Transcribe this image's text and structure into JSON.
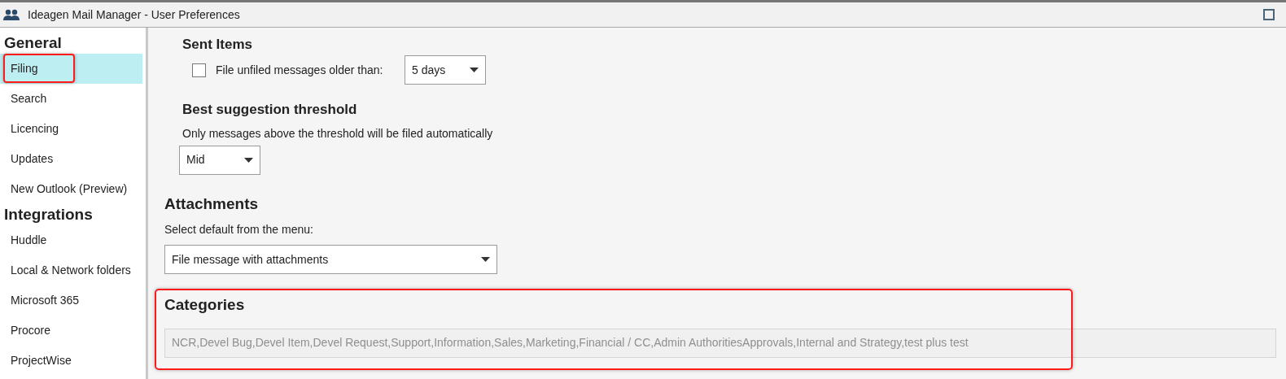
{
  "window": {
    "title": "Ideagen Mail Manager - User Preferences"
  },
  "sidebar": {
    "sections": [
      {
        "heading": "General",
        "items": [
          {
            "label": "Filing",
            "selected": true,
            "highlighted": true
          },
          {
            "label": "Search",
            "selected": false,
            "highlighted": false
          },
          {
            "label": "Licencing",
            "selected": false,
            "highlighted": false
          },
          {
            "label": "Updates",
            "selected": false,
            "highlighted": false
          },
          {
            "label": "New Outlook (Preview)",
            "selected": false,
            "highlighted": false
          }
        ]
      },
      {
        "heading": "Integrations",
        "items": [
          {
            "label": "Huddle",
            "selected": false,
            "highlighted": false
          },
          {
            "label": "Local & Network folders",
            "selected": false,
            "highlighted": false
          },
          {
            "label": "Microsoft 365",
            "selected": false,
            "highlighted": false
          },
          {
            "label": "Procore",
            "selected": false,
            "highlighted": false
          },
          {
            "label": "ProjectWise",
            "selected": false,
            "highlighted": false
          }
        ]
      }
    ]
  },
  "sent_items": {
    "heading": "Sent Items",
    "checkbox": {
      "label": "File unfiled messages older than:",
      "checked": false
    },
    "dropdown": {
      "value": "5 days"
    }
  },
  "best_suggestion": {
    "heading": "Best suggestion threshold",
    "description": "Only messages above the threshold will be filed automatically",
    "dropdown": {
      "value": "Mid"
    }
  },
  "attachments": {
    "heading": "Attachments",
    "label": "Select default from the menu:",
    "dropdown": {
      "value": "File message with attachments"
    }
  },
  "categories": {
    "heading": "Categories",
    "highlighted": true,
    "value": "NCR,Devel Bug,Devel Item,Devel Request,Support,Information,Sales,Marketing,Financial / CC,Admin AuthoritiesApprovals,Internal and Strategy,test plus test"
  }
}
